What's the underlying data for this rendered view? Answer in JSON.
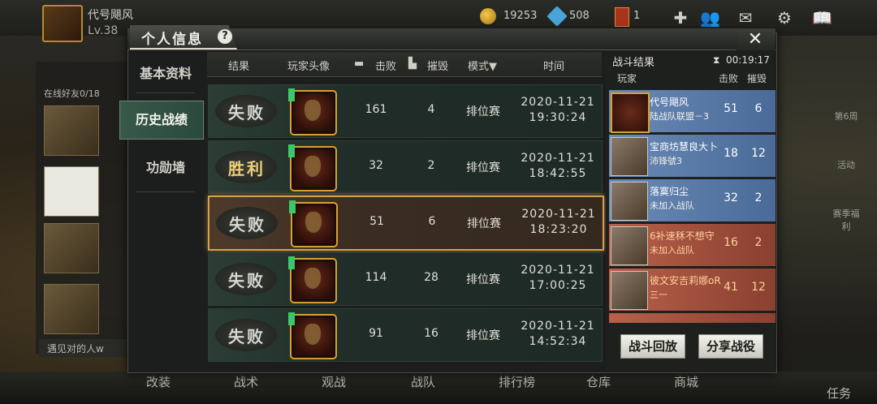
{
  "player": {
    "name": "代号飓风",
    "level": "Lv.38"
  },
  "currency": {
    "coins": "19253",
    "gems": "508",
    "cards": "1"
  },
  "side": {
    "online_friends": "在线好友0/18",
    "chat_preview": "遇见对的人w"
  },
  "right_menu": [
    "第6周",
    "活动",
    "赛季福利"
  ],
  "panel": {
    "title": "个人信息",
    "help": "?",
    "close": "✕",
    "tabs": [
      "基本资料",
      "历史战绩",
      "功勋墙"
    ],
    "active_tab": "历史战绩",
    "headers": {
      "result": "结果",
      "avatar": "玩家头像",
      "kills": "击败",
      "destroy": "摧毁",
      "mode": "模式▼",
      "time": "时间"
    },
    "rows": [
      {
        "result": "失败",
        "kills": "161",
        "destroy": "4",
        "mode": "排位赛",
        "date": "2020-11-21",
        "time": "19:30:24"
      },
      {
        "result": "胜利",
        "kills": "32",
        "destroy": "2",
        "mode": "排位赛",
        "date": "2020-11-21",
        "time": "18:42:55"
      },
      {
        "result": "失败",
        "kills": "51",
        "destroy": "6",
        "mode": "排位赛",
        "date": "2020-11-21",
        "time": "18:23:20"
      },
      {
        "result": "失败",
        "kills": "114",
        "destroy": "28",
        "mode": "排位赛",
        "date": "2020-11-21",
        "time": "17:00:25"
      },
      {
        "result": "失败",
        "kills": "91",
        "destroy": "16",
        "mode": "排位赛",
        "date": "2020-11-21",
        "time": "14:52:34"
      }
    ]
  },
  "battle": {
    "title": "战斗结果",
    "timer": "00:19:17",
    "headers": {
      "player": "玩家",
      "kills": "击败",
      "destroy": "摧毁"
    },
    "players": [
      {
        "name": "代号飓风",
        "team": "陆战队联盟－3",
        "kills": "51",
        "destroy": "6"
      },
      {
        "name": "宝商坊慧良大卜",
        "team": "沛锋號3",
        "kills": "18",
        "destroy": "12"
      },
      {
        "name": "落寞归尘",
        "team": "未加入战队",
        "kills": "32",
        "destroy": "2"
      },
      {
        "name": "6补速秝不想守",
        "team": "未加入战队",
        "kills": "16",
        "destroy": "2"
      },
      {
        "name": "彼文安吉莉娜oR",
        "team": "三一",
        "kills": "41",
        "destroy": "12"
      }
    ],
    "replay": "战斗回放",
    "share": "分享战役"
  },
  "bottom_nav": [
    "改装",
    "战术",
    "观战",
    "战队",
    "排行榜",
    "仓库",
    "商城",
    "任务"
  ]
}
